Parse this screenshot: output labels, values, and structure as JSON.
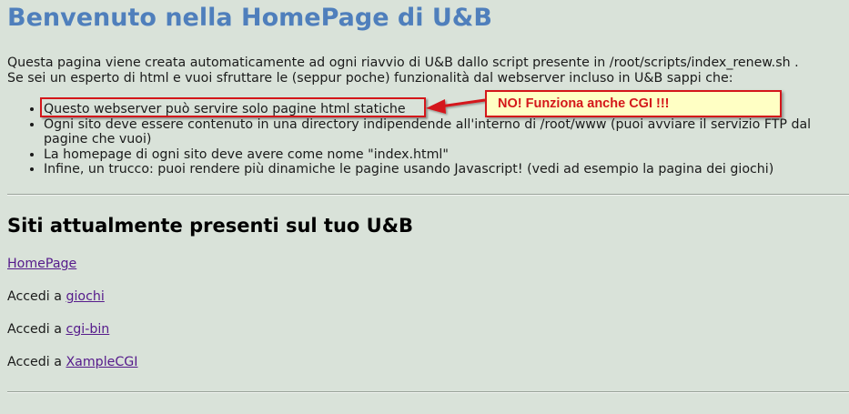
{
  "header": {
    "title": "Benvenuto nella HomePage di U&B"
  },
  "intro": {
    "line1": "Questa pagina viene creata automaticamente ad ogni riavvio di U&B dallo script presente in /root/scripts/index_renew.sh .",
    "line2": "Se sei un esperto di html e vuoi sfruttare le (seppur poche) funzionalità dal webserver incluso in U&B sappi che:"
  },
  "rules": [
    "Questo webserver può servire solo pagine html statiche",
    "Ogni sito deve essere contenuto in una directory indipendende all'interno di /root/www (puoi avviare il servizio FTP dal pagine che vuoi)",
    "La homepage di ogni sito deve avere come nome \"index.html\"",
    "Infine, un trucco: puoi rendere più dinamiche le pagine usando Javascript! (vedi ad esempio la pagina dei giochi)"
  ],
  "annotation": {
    "callout_text": "NO! Funziona anche CGI !!!",
    "color": "#d4161a",
    "background": "#ffffc4"
  },
  "sites": {
    "heading": "Siti attualmente presenti sul tuo U&B",
    "homepage_link": "HomePage",
    "access_prefix": "Accedi a",
    "links": [
      "giochi",
      "cgi-bin",
      "XampleCGI"
    ]
  },
  "colors": {
    "background": "#d9e2d9",
    "title": "#4f7fbc",
    "link_visited": "#551a8b"
  }
}
